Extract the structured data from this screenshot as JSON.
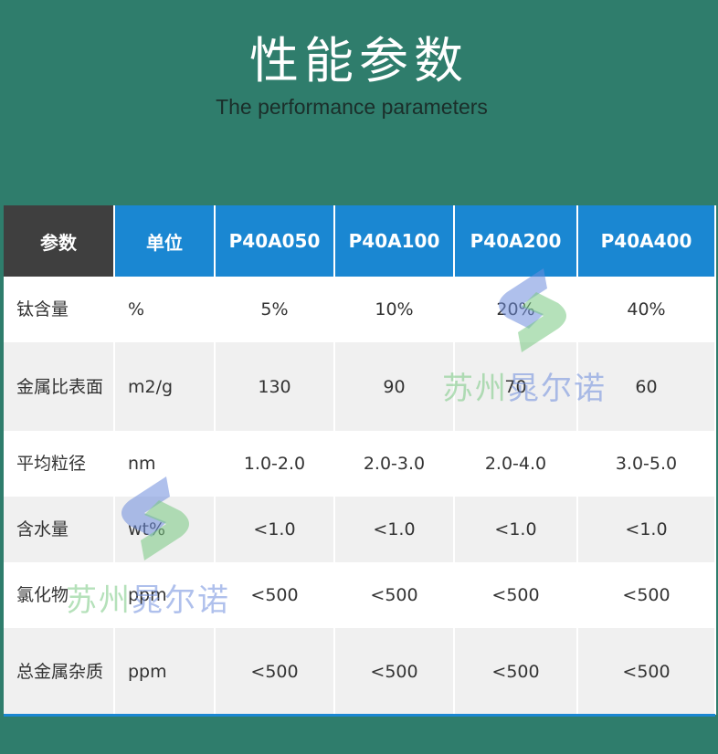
{
  "page": {
    "title": "性能参数",
    "subtitle": "The performance parameters"
  },
  "table": {
    "headers": [
      "参数",
      "单位",
      "P40A050",
      "P40A100",
      "P40A200",
      "P40A400"
    ],
    "rows": [
      {
        "label": "钛含量",
        "unit": "%",
        "values": [
          "5%",
          "10%",
          "20%",
          "40%"
        ]
      },
      {
        "label": "金属比表面",
        "unit": "m2/g",
        "values": [
          "130",
          "90",
          "70",
          "60"
        ]
      },
      {
        "label": "平均粒径",
        "unit": "nm",
        "values": [
          "1.0-2.0",
          "2.0-3.0",
          "2.0-4.0",
          "3.0-5.0"
        ]
      },
      {
        "label": "含水量",
        "unit": "wt%",
        "values": [
          "<1.0",
          "<1.0",
          "<1.0",
          "<1.0"
        ]
      },
      {
        "label": "氯化物",
        "unit": "ppm",
        "values": [
          "<500",
          "<500",
          "<500",
          "<500"
        ]
      },
      {
        "label": "总金属杂质",
        "unit": "ppm",
        "values": [
          "<500",
          "<500",
          "<500",
          "<500"
        ]
      }
    ]
  },
  "watermark": {
    "text_green": "苏州",
    "text_blue": "晁尔诺",
    "logo_icon": "s-shape-logo-icon"
  },
  "colors": {
    "background": "#2f7d6c",
    "header_blue": "#1a87d2",
    "header_dark": "#3f3f3f",
    "row_alt": "#f0f0f0"
  }
}
